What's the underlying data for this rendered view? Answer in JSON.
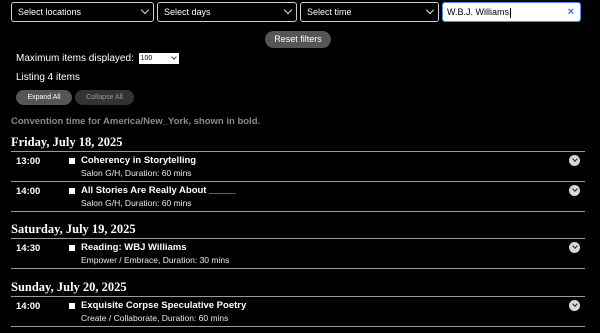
{
  "filters": {
    "locations": "Select locations",
    "days": "Select days",
    "time": "Select time",
    "search_value": "W.B.J. Williams",
    "clear_icon": "×"
  },
  "reset_label": "Reset filters",
  "max_items": {
    "label": "Maximum items displayed:",
    "value": "100"
  },
  "listing": "Listing 4 items",
  "expand_label": "Expand All",
  "collapse_label": "Collapse All",
  "tz_note": "Convention time for America/New_York, shown in bold.",
  "days": [
    {
      "heading": "Friday, July 18, 2025",
      "items": [
        {
          "time": "13:00",
          "title": "Coherency in Storytelling",
          "sub": "Salon G/H,  Duration: 60 mins"
        },
        {
          "time": "14:00",
          "title": "All Stories Are Really About _____",
          "sub": "Salon G/H,  Duration: 60 mins"
        }
      ]
    },
    {
      "heading": "Saturday, July 19, 2025",
      "items": [
        {
          "time": "14:30",
          "title": "Reading: WBJ Williams",
          "sub": "Empower / Embrace,  Duration: 30 mins"
        }
      ]
    },
    {
      "heading": "Sunday, July 20, 2025",
      "items": [
        {
          "time": "14:00",
          "title": "Exquisite Corpse Speculative Poetry",
          "sub": "Create / Collaborate,  Duration: 60 mins"
        }
      ]
    }
  ]
}
